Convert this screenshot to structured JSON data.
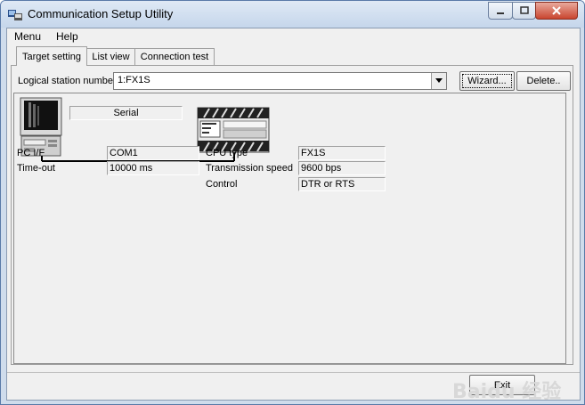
{
  "window": {
    "title": "Communication Setup Utility"
  },
  "menu": {
    "items": [
      "Menu",
      "Help"
    ]
  },
  "tabs": [
    "Target setting",
    "List view",
    "Connection test"
  ],
  "station": {
    "label": "Logical station number",
    "value": "1:FX1S"
  },
  "buttons": {
    "wizard": "Wizard...",
    "delete": "Delete..",
    "exit": "Exit"
  },
  "diagram": {
    "link": "Serial"
  },
  "pc": {
    "fields": [
      {
        "label": "PC I/F",
        "value": "COM1"
      },
      {
        "label": "Time-out",
        "value": "10000 ms"
      }
    ]
  },
  "plc": {
    "fields": [
      {
        "label": "CPU type",
        "value": "FX1S"
      },
      {
        "label": "Transmission speed",
        "value": "9600 bps"
      },
      {
        "label": "Control",
        "value": "DTR or RTS"
      }
    ]
  },
  "watermark": "Baidu 经验"
}
